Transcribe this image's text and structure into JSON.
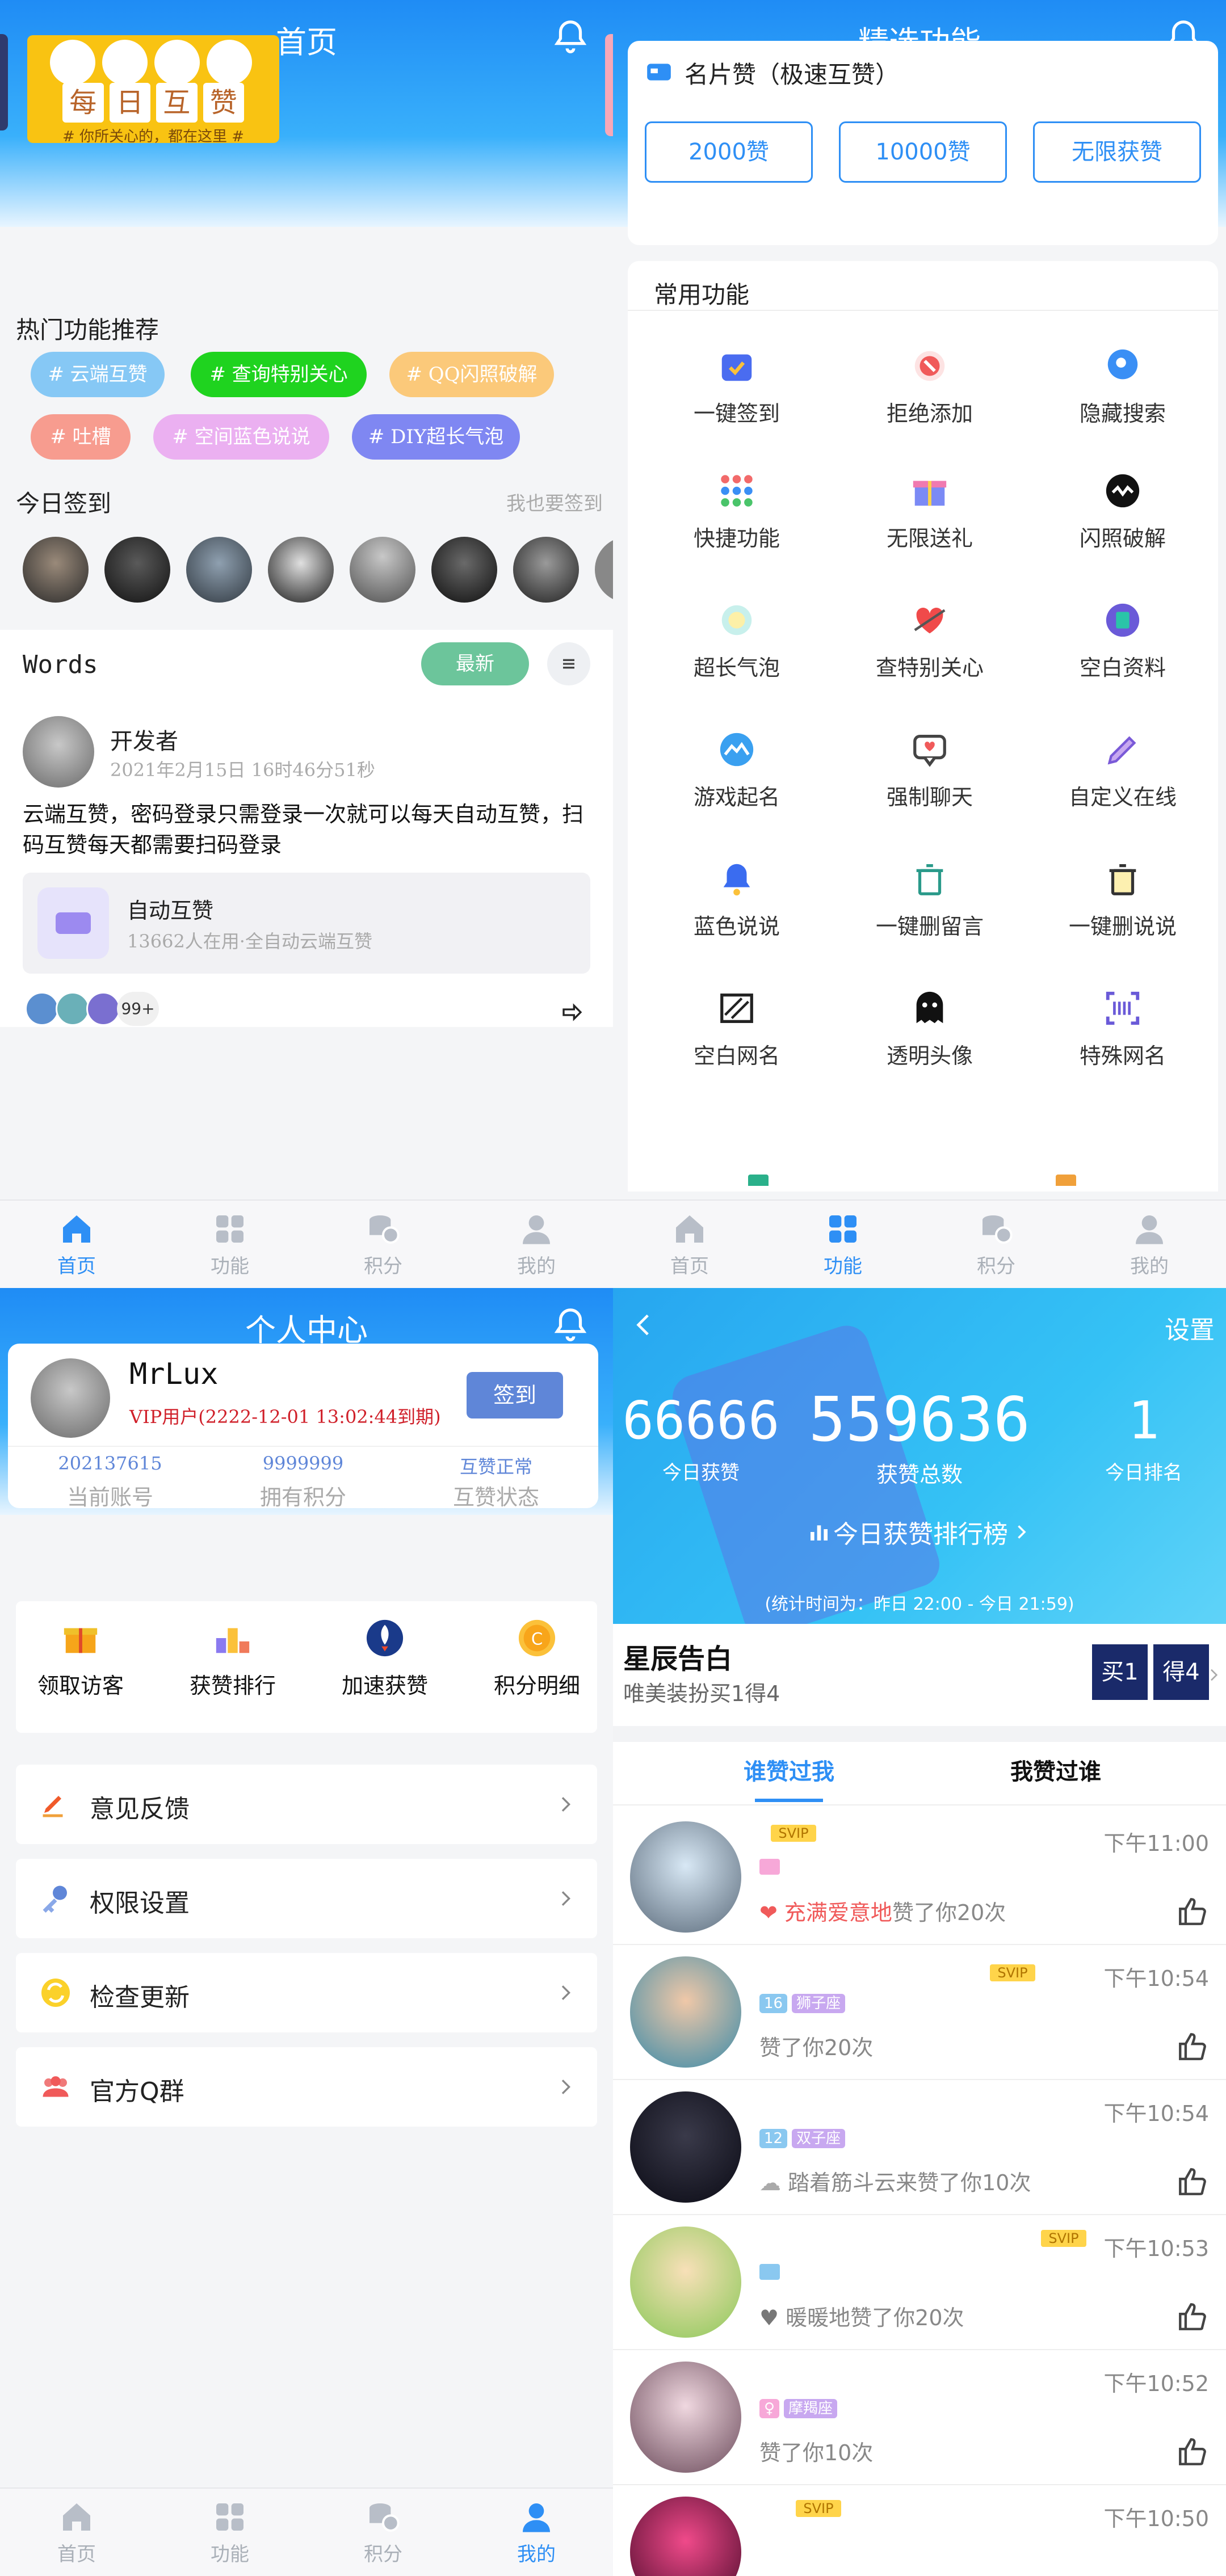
{
  "home": {
    "title": "首页",
    "banner": {
      "main": "每日互赞",
      "chars": [
        "每",
        "日",
        "互",
        "赞"
      ],
      "sub": "# 你所关心的，都在这里 #"
    },
    "hot_title": "热门功能推荐",
    "tags": [
      {
        "label": "# 云端互赞",
        "color": "#86c8f5"
      },
      {
        "label": "# 查询特别关心",
        "color": "#1fd31f"
      },
      {
        "label": "# QQ闪照破解",
        "color": "#fbc97a"
      },
      {
        "label": "# 吐槽",
        "color": "#f79c8f"
      },
      {
        "label": "# 空间蓝色说说",
        "color": "#ebb0f1"
      },
      {
        "label": "# DIY超长气泡",
        "color": "#7f87f2"
      }
    ],
    "checkin_title": "今日签到",
    "checkin_link": "我也要签到",
    "words_title": "Words",
    "latest_button": "最新",
    "post": {
      "author": "开发者",
      "time": "2021年2月15日 16时46分51秒",
      "content": "云端互赞，密码登录只需登录一次就可以每天自动互赞，扫码互赞每天都需要扫码登录",
      "app_title": "自动互赞",
      "app_sub": "13662人在用·全自动云端互赞",
      "count": "99+"
    }
  },
  "features": {
    "title": "精选功能",
    "card_title": "名片赞（极速互赞）",
    "buttons": [
      "2000赞",
      "10000赞",
      "无限获赞"
    ],
    "common_title": "常用功能",
    "items": [
      {
        "label": "一键签到",
        "icon": "calendar-check-icon"
      },
      {
        "label": "拒绝添加",
        "icon": "block-icon"
      },
      {
        "label": "隐藏搜索",
        "icon": "search-bubble-icon"
      },
      {
        "label": "快捷功能",
        "icon": "grid-dots-icon"
      },
      {
        "label": "无限送礼",
        "icon": "gift-icon"
      },
      {
        "label": "闪照破解",
        "icon": "flash-photo-icon"
      },
      {
        "label": "超长气泡",
        "icon": "bubble-icon"
      },
      {
        "label": "查特别关心",
        "icon": "heart-arrow-icon"
      },
      {
        "label": "空白资料",
        "icon": "profile-icon"
      },
      {
        "label": "游戏起名",
        "icon": "game-icon"
      },
      {
        "label": "强制聊天",
        "icon": "chat-icon"
      },
      {
        "label": "自定义在线",
        "icon": "pencil-icon"
      },
      {
        "label": "蓝色说说",
        "icon": "bell-blue-icon"
      },
      {
        "label": "一键删留言",
        "icon": "trash-icon"
      },
      {
        "label": "一键删说说",
        "icon": "trash-doc-icon"
      },
      {
        "label": "空白网名",
        "icon": "stripes-icon"
      },
      {
        "label": "透明头像",
        "icon": "ghost-icon"
      },
      {
        "label": "特殊网名",
        "icon": "barcode-icon"
      }
    ]
  },
  "profile": {
    "title": "个人中心",
    "name": "MrLux",
    "vip": "VIP用户(2222-12-01 13:02:44到期)",
    "sign_button": "签到",
    "stats": [
      {
        "value": "202137615",
        "label": "当前账号"
      },
      {
        "value": "9999999",
        "label": "拥有积分"
      },
      {
        "value": "互赞正常",
        "label": "互赞状态"
      }
    ],
    "actions": [
      {
        "label": "领取访客",
        "icon": "gift-box-icon"
      },
      {
        "label": "获赞排行",
        "icon": "podium-icon"
      },
      {
        "label": "加速获赞",
        "icon": "rocket-icon"
      },
      {
        "label": "积分明细",
        "icon": "coin-icon"
      }
    ],
    "menu": [
      {
        "label": "意见反馈",
        "icon": "feedback-icon"
      },
      {
        "label": "权限设置",
        "icon": "key-icon"
      },
      {
        "label": "检查更新",
        "icon": "refresh-icon"
      },
      {
        "label": "官方Q群",
        "icon": "group-icon"
      }
    ]
  },
  "likes": {
    "settings": "设置",
    "today_likes": "66666",
    "today_likes_label": "今日获赞",
    "total_likes": "559636",
    "total_likes_label": "获赞总数",
    "rank": "1",
    "rank_label": "今日排名",
    "ranking_link": "今日获赞排行榜",
    "stat_time": "(统计时间为：昨日 22:00 - 今日 21:59)",
    "promo_title": "星辰告白",
    "promo_sub": "唯美装扮买1得4",
    "promo_badges": [
      "买1",
      "得4"
    ],
    "tab_liked_me": "谁赞过我",
    "tab_i_liked": "我赞过谁",
    "list": [
      {
        "time": "下午11:00",
        "tags": [],
        "name": "充满爱意地",
        "msg": "赞了你20次"
      },
      {
        "time": "下午10:54",
        "tags": [
          "16",
          "狮子座"
        ],
        "name": "",
        "msg": "赞了你20次"
      },
      {
        "time": "下午10:54",
        "tags": [
          "12",
          "双子座"
        ],
        "name": "踏着筋斗云来",
        "msg": "赞了你10次"
      },
      {
        "time": "下午10:53",
        "tags": [],
        "name": "暖暖地",
        "msg": "赞了你20次"
      },
      {
        "time": "下午10:52",
        "tags": [
          "摩羯座"
        ],
        "name": "",
        "msg": "赞了你10次"
      },
      {
        "time": "下午10:50",
        "tags": [],
        "name": "",
        "msg": ""
      }
    ],
    "svip": "SVIP"
  },
  "tabbar": [
    "首页",
    "功能",
    "积分",
    "我的"
  ]
}
